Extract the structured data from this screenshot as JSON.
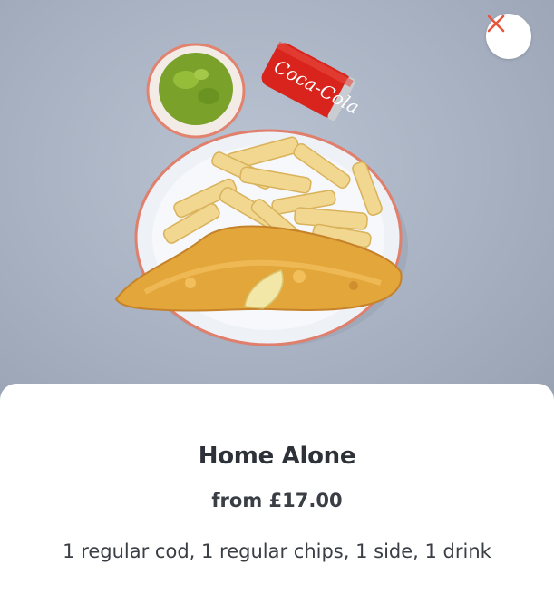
{
  "product": {
    "name": "Home Alone",
    "price": "from £17.00",
    "description": "1 regular cod, 1 regular chips, 1 side, 1 drink"
  },
  "image": {
    "can_text": "Coca-Cola"
  },
  "icons": {
    "close": "close-icon"
  },
  "colors": {
    "accent": "#e8553e",
    "text": "#2d3138"
  }
}
